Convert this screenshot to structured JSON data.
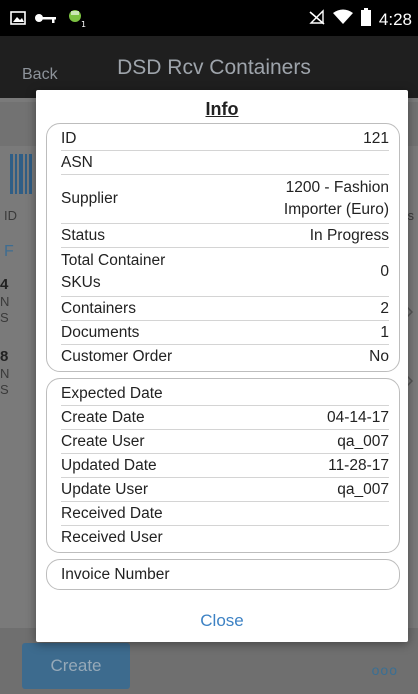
{
  "status_bar": {
    "left_icons": [
      "image-icon",
      "key-icon",
      "android-badge-icon"
    ],
    "right_icons": [
      "no-signal-icon",
      "wifi-icon",
      "battery-icon"
    ],
    "time": "4:28"
  },
  "app_bar": {
    "back_label": "Back",
    "title": "DSD Rcv Containers"
  },
  "background": {
    "fragments": [
      "ID",
      "rs",
      "F",
      "4",
      "N",
      "S",
      "8",
      "N",
      "S"
    ],
    "create_label": "Create",
    "more_label": "ooo"
  },
  "dialog": {
    "title": "Info",
    "group1": [
      {
        "label": "ID",
        "value": "121"
      },
      {
        "label": "ASN",
        "value": ""
      },
      {
        "label": "Supplier",
        "value": "1200 - Fashion Importer (Euro)"
      },
      {
        "label": "Status",
        "value": "In Progress"
      },
      {
        "label": "Total Container SKUs",
        "value": "0"
      },
      {
        "label": "Containers",
        "value": "2"
      },
      {
        "label": "Documents",
        "value": "1"
      },
      {
        "label": "Customer Order",
        "value": "No"
      }
    ],
    "group2": [
      {
        "label": "Expected Date",
        "value": ""
      },
      {
        "label": "Create Date",
        "value": "04-14-17"
      },
      {
        "label": "Create User",
        "value": "qa_007"
      },
      {
        "label": "Updated Date",
        "value": "11-28-17"
      },
      {
        "label": "Update User",
        "value": "qa_007"
      },
      {
        "label": "Received Date",
        "value": ""
      },
      {
        "label": "Received User",
        "value": ""
      }
    ],
    "group3": [
      {
        "label": "Invoice Number",
        "value": ""
      }
    ],
    "close_label": "Close"
  }
}
